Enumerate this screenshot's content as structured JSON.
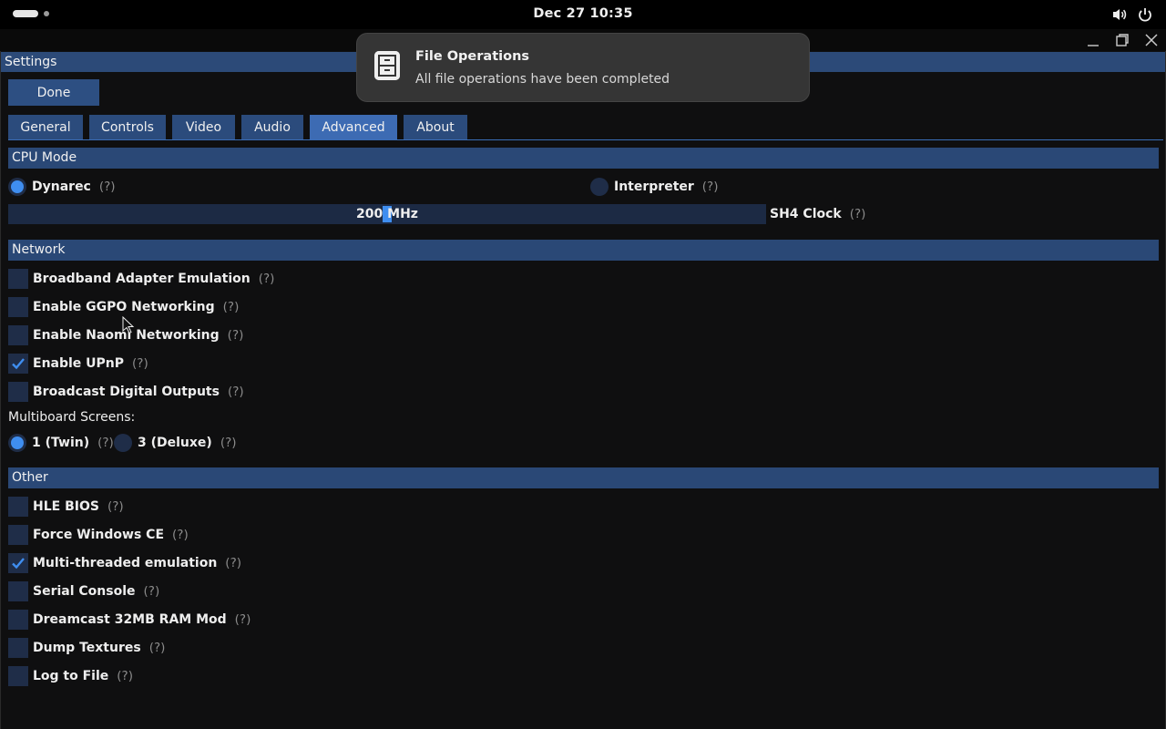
{
  "system": {
    "clock": "Dec 27  10:35"
  },
  "notification": {
    "title": "File Operations",
    "body": "All file operations have been completed",
    "icon": "file-cabinet-icon"
  },
  "window": {
    "title": "Settings",
    "done_label": "Done"
  },
  "tabs": [
    {
      "label": "General",
      "active": false
    },
    {
      "label": "Controls",
      "active": false
    },
    {
      "label": "Video",
      "active": false
    },
    {
      "label": "Audio",
      "active": false
    },
    {
      "label": "Advanced",
      "active": true
    },
    {
      "label": "About",
      "active": false
    }
  ],
  "help": "(?)",
  "cpu": {
    "header": "CPU Mode",
    "dynarec": {
      "label": "Dynarec",
      "selected": true
    },
    "interpreter": {
      "label": "Interpreter",
      "selected": false
    },
    "clock_value": "200 MHz",
    "clock_label": "SH4 Clock"
  },
  "network": {
    "header": "Network",
    "items": [
      {
        "label": "Broadband Adapter Emulation",
        "checked": false
      },
      {
        "label": "Enable GGPO Networking",
        "checked": false
      },
      {
        "label": "Enable Naomi Networking",
        "checked": false
      },
      {
        "label": "Enable UPnP",
        "checked": true
      },
      {
        "label": "Broadcast Digital Outputs",
        "checked": false
      }
    ],
    "multiboard_label": "Multiboard Screens:",
    "multiboard_options": [
      {
        "label": "1 (Twin)",
        "selected": true
      },
      {
        "label": "3 (Deluxe)",
        "selected": false
      }
    ]
  },
  "other": {
    "header": "Other",
    "items": [
      {
        "label": "HLE BIOS",
        "checked": false
      },
      {
        "label": "Force Windows CE",
        "checked": false
      },
      {
        "label": "Multi-threaded emulation",
        "checked": true
      },
      {
        "label": "Serial Console",
        "checked": false
      },
      {
        "label": "Dreamcast 32MB RAM Mod",
        "checked": false
      },
      {
        "label": "Dump Textures",
        "checked": false
      },
      {
        "label": "Log to File",
        "checked": false
      }
    ]
  },
  "colors": {
    "accent": "#3f8ef0",
    "section": "#2a4876",
    "tab_active": "#3d6bb3"
  }
}
